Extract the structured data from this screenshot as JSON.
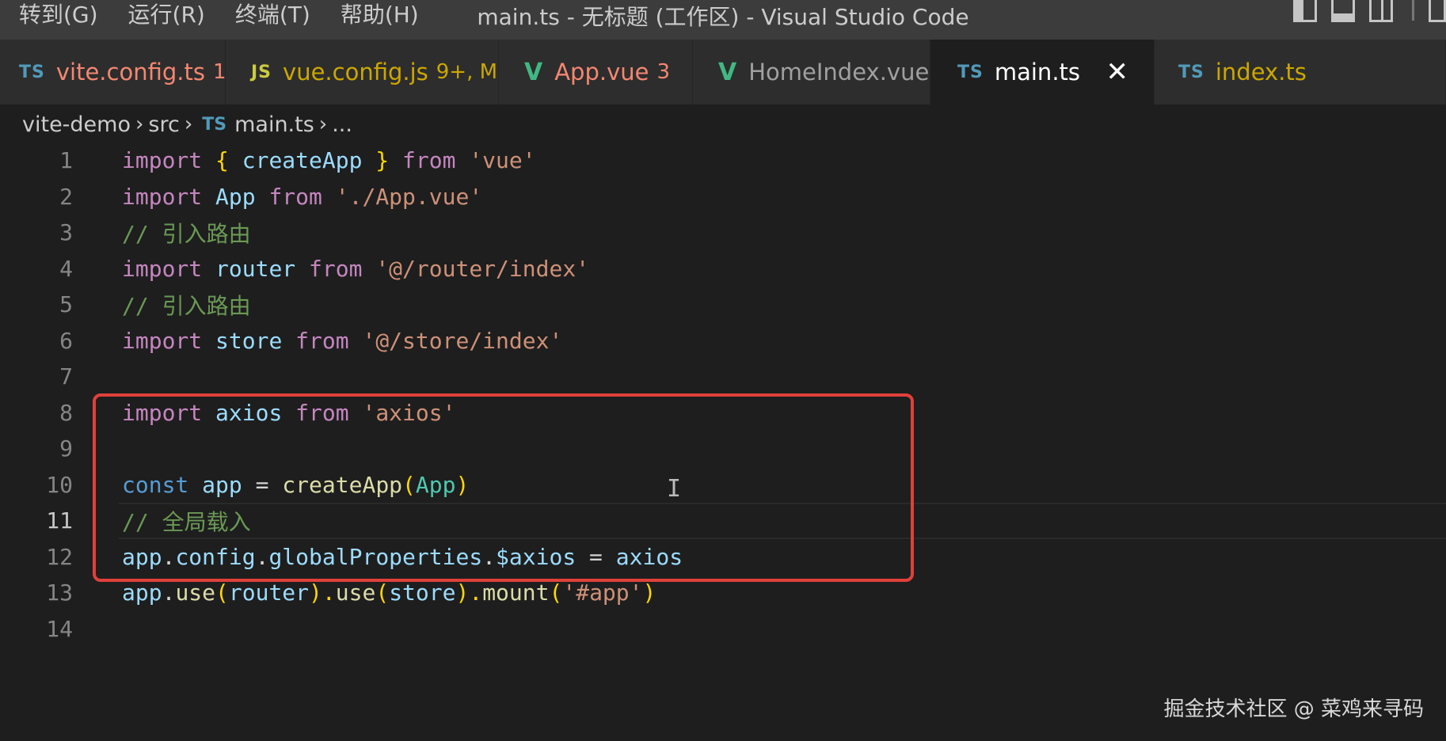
{
  "menu": [
    "转到(G)",
    "运行(R)",
    "终端(T)",
    "帮助(H)"
  ],
  "window_title": "main.ts - 无标题 (工作区) - Visual Studio Code",
  "tabs": [
    {
      "icon": "TS",
      "label": "vite.config.ts",
      "badge": "1",
      "color": "#f48771",
      "badge_color": "#f48771",
      "active": false
    },
    {
      "icon": "JS",
      "label": "vue.config.js",
      "badge": "9+, M",
      "color": "#cca700",
      "badge_color": "#cca700",
      "active": false
    },
    {
      "icon": "V",
      "label": "App.vue",
      "badge": "3",
      "color": "#f48771",
      "badge_color": "#f48771",
      "active": false
    },
    {
      "icon": "V",
      "label": "HomeIndex.vue",
      "badge": "",
      "color": "#a0a0a0",
      "badge_color": "#a0a0a0",
      "active": false
    },
    {
      "icon": "TS",
      "label": "main.ts",
      "badge": "",
      "color": "#ffffff",
      "badge_color": "#ffffff",
      "active": true
    },
    {
      "icon": "TS",
      "label": "index.ts",
      "badge": "",
      "color": "#cca700",
      "badge_color": "#cca700",
      "active": false
    }
  ],
  "breadcrumb": {
    "folder": "vite-demo",
    "subfolder": "src",
    "file_icon": "TS",
    "file": "main.ts",
    "more": "..."
  },
  "code_lines": [
    {
      "n": "1"
    },
    {
      "n": "2"
    },
    {
      "n": "3"
    },
    {
      "n": "4"
    },
    {
      "n": "5"
    },
    {
      "n": "6"
    },
    {
      "n": "7"
    },
    {
      "n": "8"
    },
    {
      "n": "9"
    },
    {
      "n": "10"
    },
    {
      "n": "11"
    },
    {
      "n": "12"
    },
    {
      "n": "13"
    },
    {
      "n": "14"
    }
  ],
  "current_line": "11",
  "code": {
    "l1": [
      "import",
      " { ",
      "createApp",
      " } ",
      "from",
      " ",
      "'vue'"
    ],
    "l2": [
      "import",
      " ",
      "App",
      " ",
      "from",
      " ",
      "'./App.vue'"
    ],
    "l3": [
      "// 引入路由"
    ],
    "l4": [
      "import",
      " ",
      "router",
      " ",
      "from",
      " ",
      "'@/router/index'"
    ],
    "l5": [
      "// 引入路由"
    ],
    "l6": [
      "import",
      " ",
      "store",
      " ",
      "from",
      " ",
      "'@/store/index'"
    ],
    "l8": [
      "import",
      " ",
      "axios",
      " ",
      "from",
      " ",
      "'axios'"
    ],
    "l10": [
      "const",
      " ",
      "app",
      " = ",
      "createApp",
      "(",
      "App",
      ")"
    ],
    "l11": [
      "// 全局载入"
    ],
    "l12": [
      "app",
      ".",
      "config",
      ".",
      "globalProperties",
      ".",
      "$axios",
      " = ",
      "axios"
    ],
    "l13": [
      "app",
      ".",
      "use",
      "(",
      "router",
      ").",
      "use",
      "(",
      "store",
      ").",
      "mount",
      "(",
      "'#app'",
      ")"
    ]
  },
  "cursor_glyph": "I",
  "watermark": "掘金技术社区 @ 菜鸡来寻码",
  "colors": {
    "highlight_box": "#e0403a",
    "background": "#1e1e1e"
  }
}
